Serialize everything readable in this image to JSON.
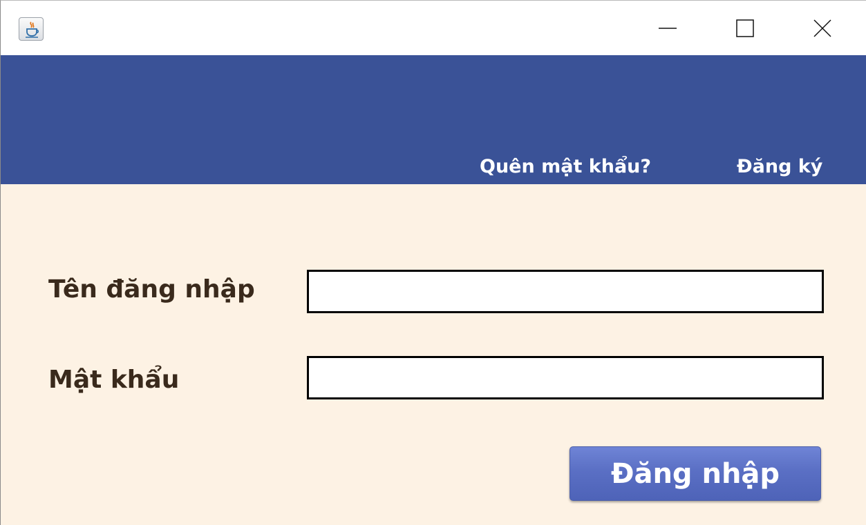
{
  "titlebar": {
    "app_icon": "java-coffee-cup-icon",
    "buttons": {
      "minimize": "minimize-icon",
      "maximize": "maximize-icon",
      "close": "close-icon"
    }
  },
  "header": {
    "forgot_password_link": "Quên mật khẩu?",
    "register_link": "Đăng ký",
    "background_color": "#3a5297"
  },
  "form": {
    "username_label": "Tên đăng nhập",
    "username_value": "",
    "password_label": "Mật khẩu",
    "password_value": "",
    "login_button": "Đăng nhập",
    "background_color": "#fdf2e4"
  }
}
